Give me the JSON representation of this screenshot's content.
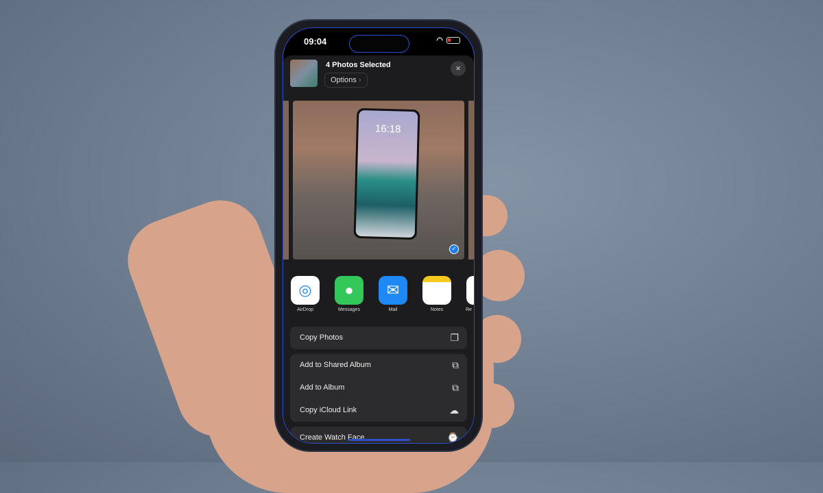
{
  "status_bar": {
    "time": "09:04"
  },
  "header": {
    "title": "4 Photos Selected",
    "options_label": "Options",
    "options_chevron": "›",
    "close_icon": "×"
  },
  "preview": {
    "phone_time": "16:18",
    "selected_mark": "✓"
  },
  "apps": [
    {
      "label": "AirDrop",
      "icon": "airdrop-icon",
      "color": "#ffffff"
    },
    {
      "label": "Messages",
      "icon": "messages-icon",
      "color": "#34c759"
    },
    {
      "label": "Mail",
      "icon": "mail-icon",
      "color": "#1e88f5"
    },
    {
      "label": "Notes",
      "icon": "notes-icon",
      "color": "#ffffff"
    },
    {
      "label": "Re",
      "icon": "reminders-icon",
      "color": "#ffffff"
    }
  ],
  "actions": {
    "copy_photos": "Copy Photos",
    "add_shared_album": "Add to Shared Album",
    "add_album": "Add to Album",
    "copy_icloud_link": "Copy iCloud Link",
    "create_watch_face": "Create Watch Face"
  }
}
